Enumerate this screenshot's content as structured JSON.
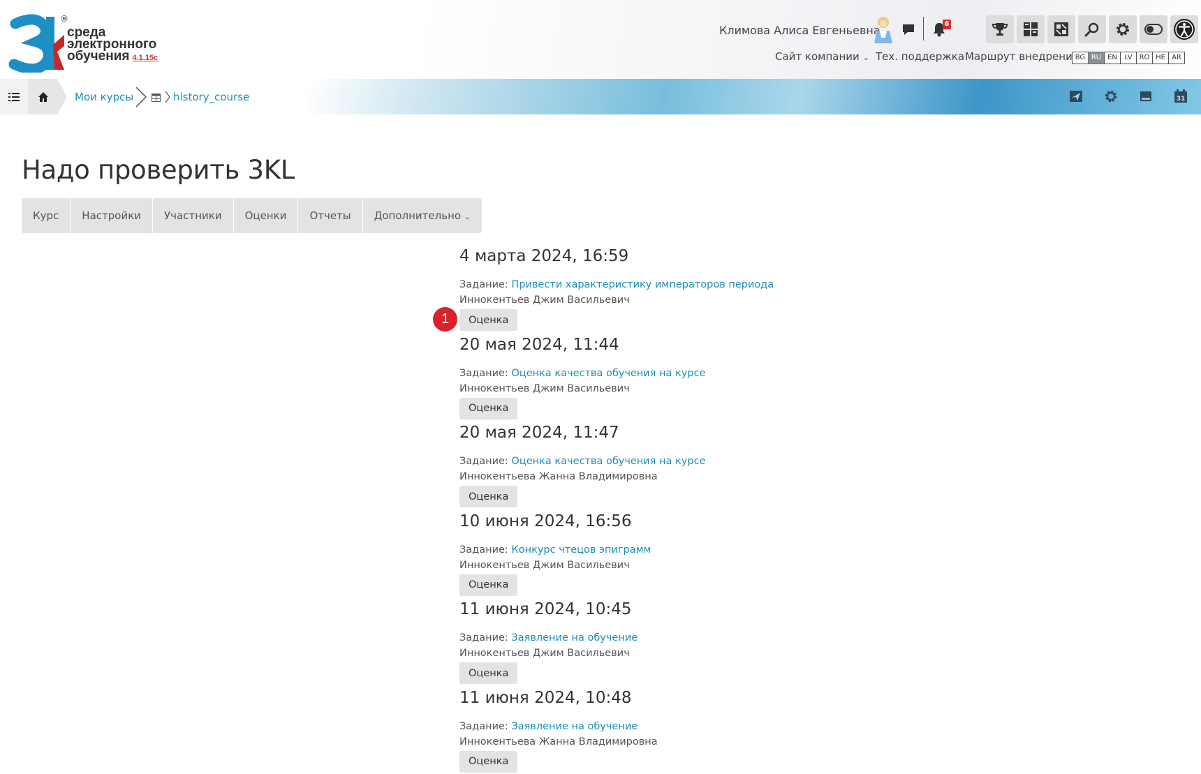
{
  "brand": {
    "logo_line1": "среда",
    "logo_line2": "электронного",
    "logo_line3": "обучения",
    "version": "4.1.15c",
    "registered": "®"
  },
  "header": {
    "user_name": "Климова Алиса Евгеньевна",
    "notifications_count": "6",
    "links": {
      "company_site": "Сайт компании",
      "support": "Тех. поддержка",
      "implementation_route": "Маршрут внедрения"
    },
    "languages": [
      "BG",
      "RU",
      "EN",
      "LV",
      "RO",
      "HE",
      "AR"
    ],
    "active_language": "RU"
  },
  "breadcrumb": {
    "my_courses": "Мои курсы",
    "course": "history_course"
  },
  "page": {
    "title": "Надо проверить 3KL",
    "tabs": [
      "Курс",
      "Настройки",
      "Участники",
      "Оценки",
      "Отчеты",
      "Дополнительно"
    ]
  },
  "task_prefix": "Задание:",
  "grade_label": "Оценка",
  "step_marker": "1",
  "entries": [
    {
      "date": "4 марта 2024, 16:59",
      "task": "Привести характеристику императоров периода",
      "student": "Иннокентьев Джим Васильевич"
    },
    {
      "date": "20 мая 2024, 11:44",
      "task": "Оценка качества обучения на курсе",
      "student": "Иннокентьев Джим Васильевич"
    },
    {
      "date": "20 мая 2024, 11:47",
      "task": "Оценка качества обучения на курсе",
      "student": "Иннокентьева Жанна Владимировна"
    },
    {
      "date": "10 июня 2024, 16:56",
      "task": "Конкурс чтецов эпиграмм",
      "student": "Иннокентьев Джим Васильевич"
    },
    {
      "date": "11 июня 2024, 10:45",
      "task": "Заявление на обучение",
      "student": "Иннокентьев Джим Васильевич"
    },
    {
      "date": "11 июня 2024, 10:48",
      "task": "Заявление на обучение",
      "student": "Иннокентьева Жанна Владимировна"
    }
  ],
  "colors": {
    "link": "#1a8fb8",
    "badge_red": "#d8232a",
    "logo_blue": "#1e8fc4",
    "logo_red": "#c62828"
  }
}
